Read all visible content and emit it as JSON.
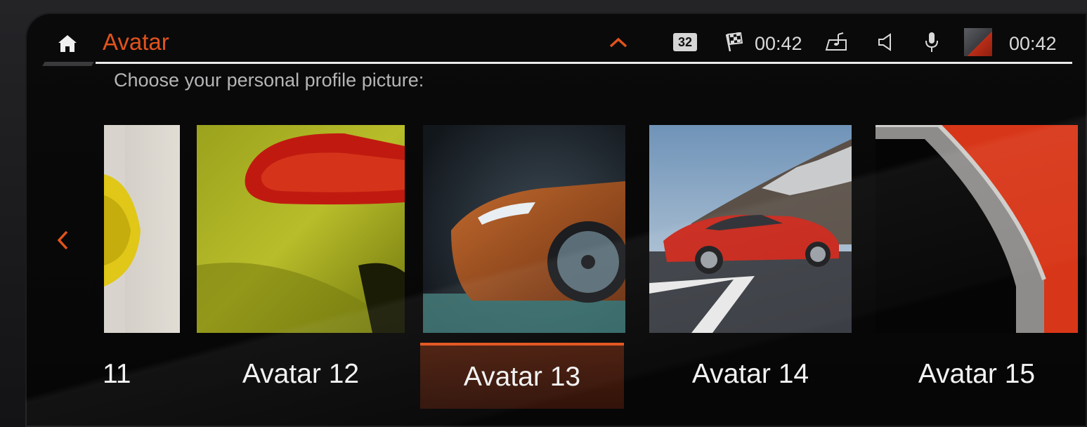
{
  "header": {
    "title": "Avatar",
    "badge": "32",
    "race_time": "00:42",
    "clock": "00:42"
  },
  "subtitle": "Choose your personal profile picture:",
  "avatars": [
    {
      "label": "11",
      "selected": false
    },
    {
      "label": "Avatar 12",
      "selected": false
    },
    {
      "label": "Avatar 13",
      "selected": true
    },
    {
      "label": "Avatar 14",
      "selected": false
    },
    {
      "label": "Avatar 15",
      "selected": false
    }
  ],
  "colors": {
    "accent": "#e2531c",
    "text": "#f2f2f2",
    "background": "#060606"
  },
  "icons": [
    "home-icon",
    "chevron-up-icon",
    "checkered-flag-icon",
    "music-icon",
    "speaker-icon",
    "microphone-icon",
    "chevron-left-icon"
  ]
}
